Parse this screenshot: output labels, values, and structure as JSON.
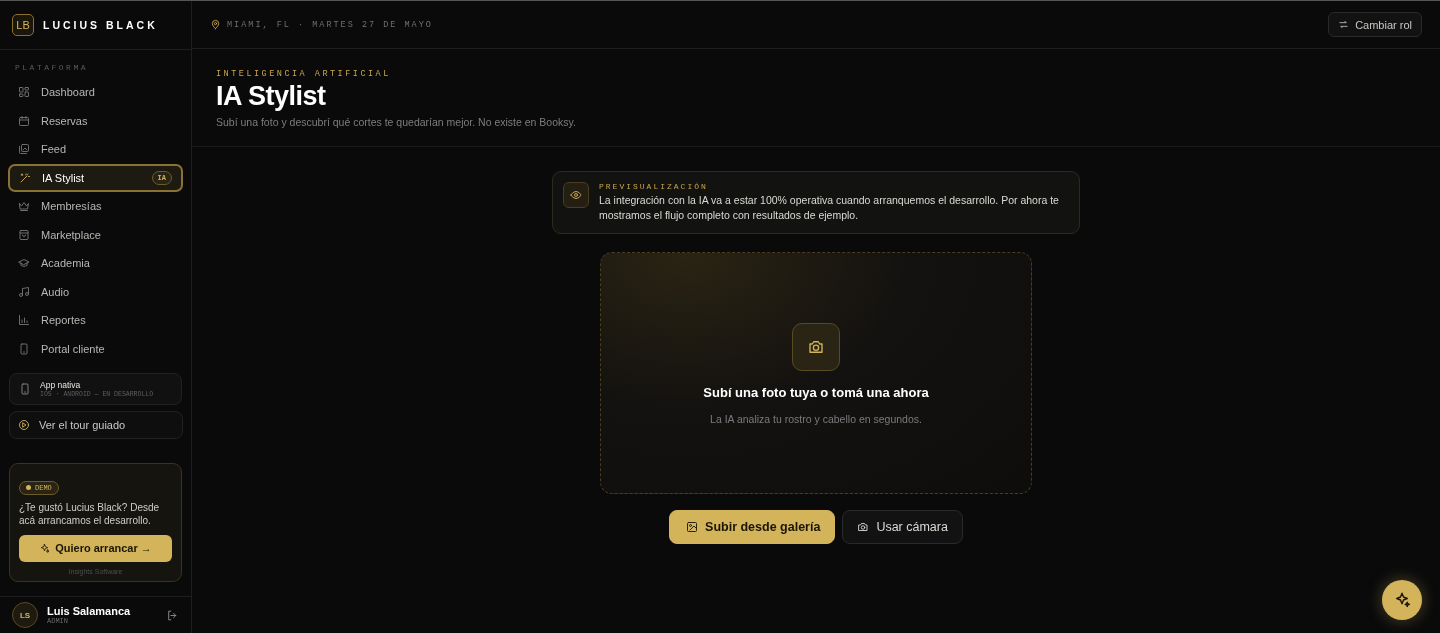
{
  "brand": {
    "initials": "LB",
    "name": "LUCIUS BLACK"
  },
  "sidebar": {
    "section": "PLATAFORMA",
    "items": [
      {
        "label": "Dashboard",
        "selected": false
      },
      {
        "label": "Reservas",
        "selected": false
      },
      {
        "label": "Feed",
        "selected": false
      },
      {
        "label": "IA Stylist",
        "selected": true,
        "badge": "IA"
      },
      {
        "label": "Membresías",
        "selected": false
      },
      {
        "label": "Marketplace",
        "selected": false
      },
      {
        "label": "Academia",
        "selected": false
      },
      {
        "label": "Audio",
        "selected": false
      },
      {
        "label": "Reportes",
        "selected": false
      },
      {
        "label": "Portal cliente",
        "selected": false
      }
    ],
    "app_card": {
      "title": "App nativa",
      "subtitle": "IOS · ANDROID — EN DESARROLLO"
    },
    "tour": "Ver el tour guiado",
    "demo": {
      "badge": "DEMO",
      "text": "¿Te gustó Lucius Black? Desde acá arrancamos el desarrollo.",
      "button": "Quiero arrancar →",
      "footer": "Insights Software"
    },
    "user": {
      "initials": "LS",
      "name": "Luis Salamanca",
      "role": "ADMIN"
    }
  },
  "topbar": {
    "location": "MIAMI, FL · MARTES 27 DE MAYO",
    "button": "Cambiar rol"
  },
  "page": {
    "eyebrow": "INTELIGENCIA ARTIFICIAL",
    "title": "IA Stylist",
    "subtitle": "Subí una foto y descubrí qué cortes te quedarían mejor. No existe en Booksy."
  },
  "notice": {
    "title": "PREVISUALIZACIÓN",
    "text": "La integración con la IA va a estar 100% operativa cuando arranquemos el desarrollo. Por ahora te mostramos el flujo completo con resultados de ejemplo."
  },
  "upload": {
    "title": "Subí una foto tuya o tomá una ahora",
    "hint": "La IA analiza tu rostro y cabello en segundos."
  },
  "actions": [
    {
      "label": "Subir desde galería",
      "kind": "primary"
    },
    {
      "label": "Usar cámara",
      "kind": "secondary"
    }
  ]
}
